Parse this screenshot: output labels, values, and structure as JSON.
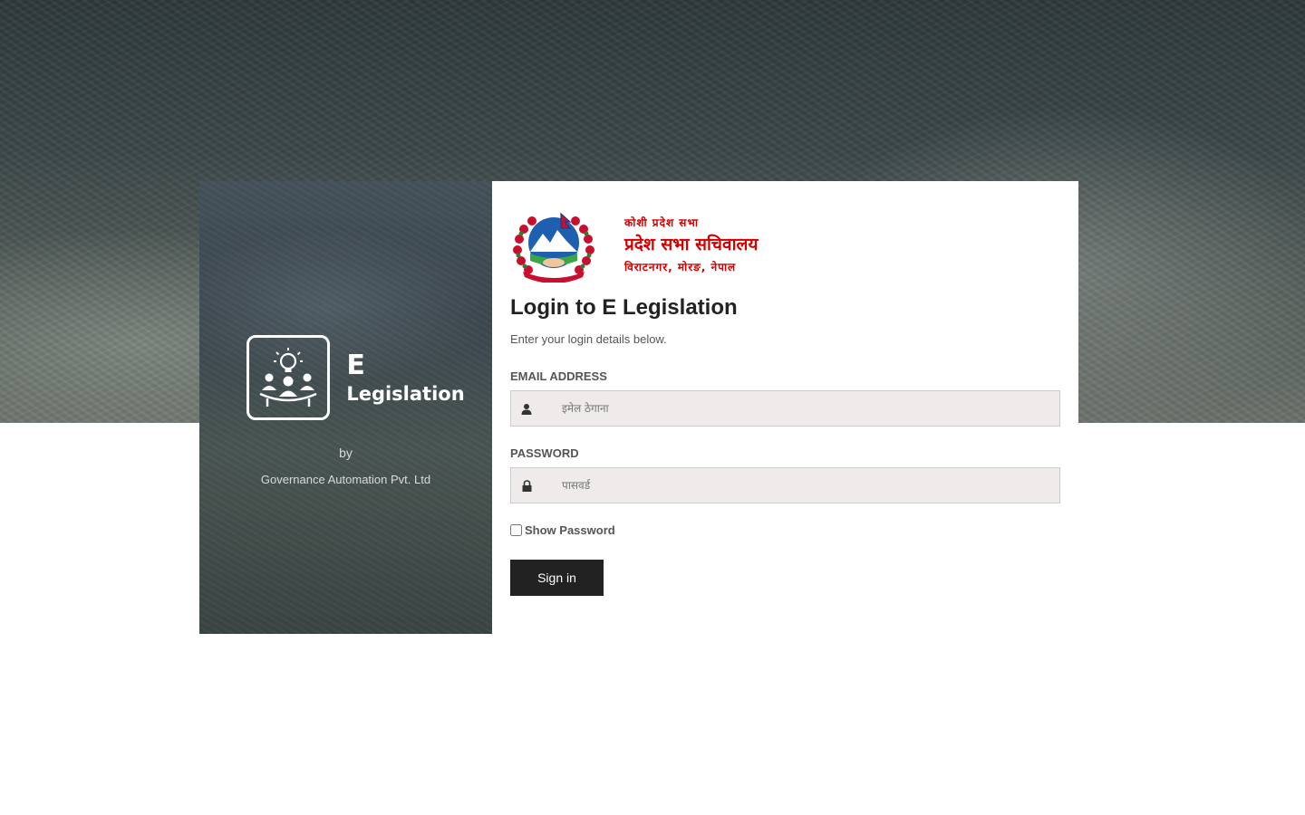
{
  "brand": {
    "logo_line1": "E",
    "logo_line2": "Legislation",
    "by": "by",
    "company": "Governance Automation Pvt. Ltd"
  },
  "government": {
    "line1": "कोशी प्रदेश सभा",
    "line2": "प्रदेश सभा सचिवालय",
    "line3": "विराटनगर, मोरङ, नेपाल",
    "text_color": "#d40000"
  },
  "login": {
    "title": "Login to E Legislation",
    "subtitle": "Enter your login details below.",
    "email_label": "EMAIL ADDRESS",
    "email_placeholder": "इमेल ठेगाना",
    "email_value": "",
    "password_label": "PASSWORD",
    "password_placeholder": "पासवर्ड",
    "password_value": "",
    "show_password_label": "Show Password",
    "show_password_checked": false,
    "signin_label": "Sign in"
  },
  "icons": {
    "email_field_icon": "user-icon",
    "password_field_icon": "lock-icon",
    "app_logo_icon": "meeting-idea-icon",
    "emblem": "nepal-emblem"
  },
  "colors": {
    "button_bg": "#222222",
    "input_bg": "#efebea",
    "title_color": "#222222"
  }
}
